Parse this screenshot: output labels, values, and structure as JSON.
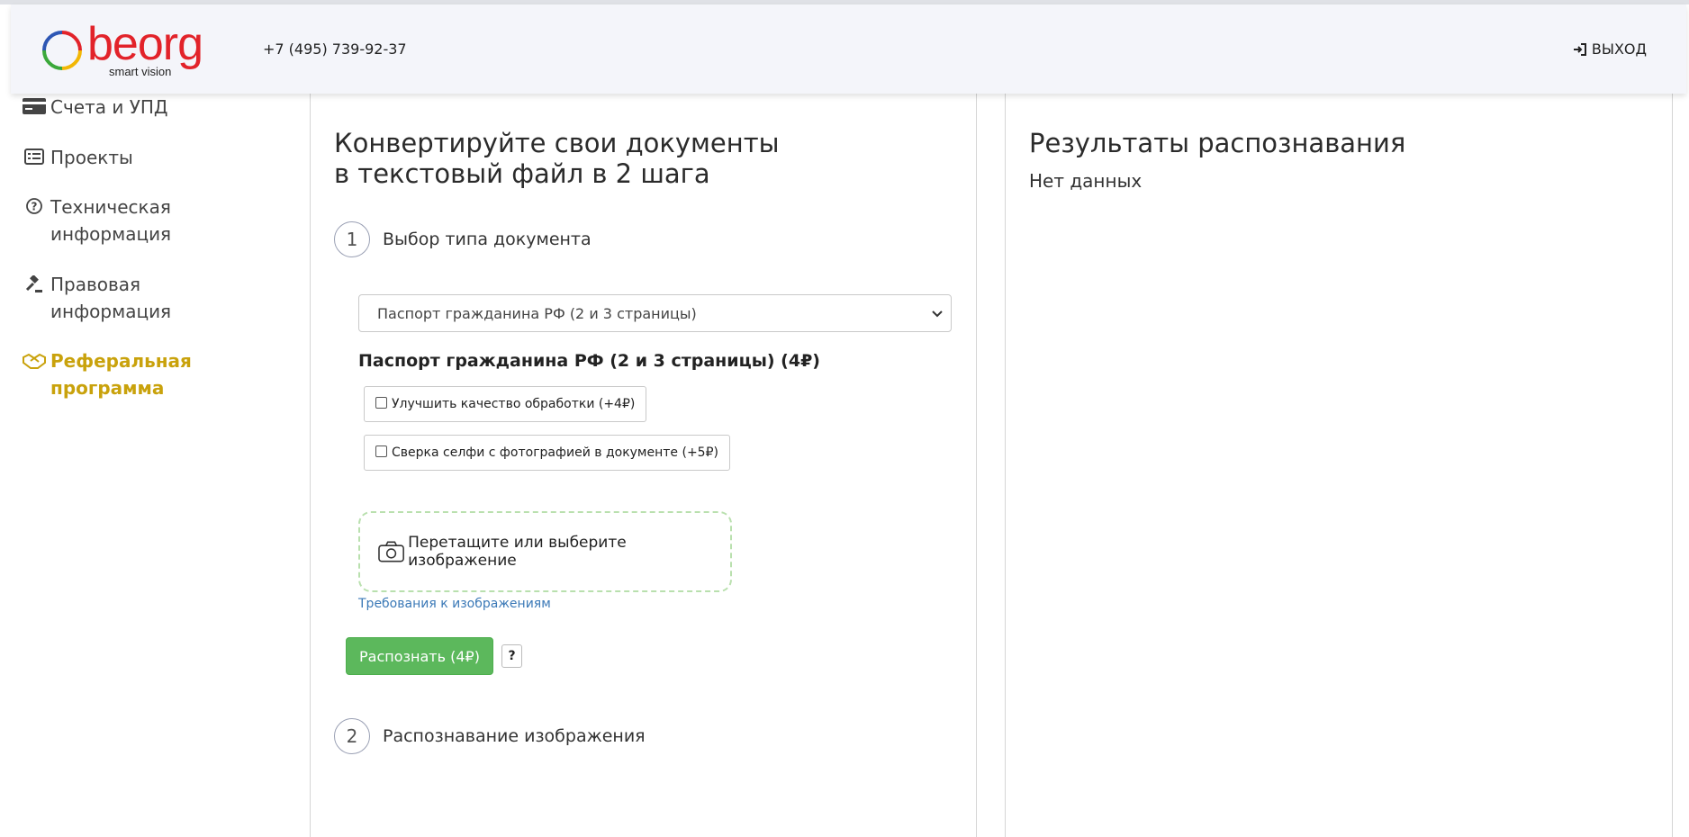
{
  "header": {
    "logo_text": "beorg",
    "logo_sub": "smart vision",
    "phone": "+7 (495) 739-92-37",
    "logout_label": "ВЫХОД"
  },
  "sidebar": {
    "items": [
      {
        "label": "Счета и УПД",
        "icon": "credit-card-icon"
      },
      {
        "label": "Проекты",
        "icon": "list-icon"
      },
      {
        "label": "Техническая\nинформация",
        "icon": "question-circle-icon"
      },
      {
        "label": "Правовая\nинформация",
        "icon": "gavel-icon"
      },
      {
        "label": "Реферальная\nпрограмма",
        "icon": "handshake-icon",
        "active": true
      }
    ],
    "active_color": "#c9a20c"
  },
  "main": {
    "title_line1": "Конвертируйте свои документы",
    "title_line2": "в текстовый файл в 2 шага",
    "step1_num": "1",
    "step1_label": "Выбор типа документа",
    "select_value": "Паспорт гражданина РФ (2 и 3 страницы)",
    "doc_title": "Паспорт гражданина РФ (2 и 3 страницы) (4₽)",
    "option1": "Улучшить качество обработки (+4₽)",
    "option2": "Сверка селфи с фотографией в документе (+5₽)",
    "drop_label": "Перетащите или выберите изображение",
    "requirements_link": "Требования к изображениям",
    "recognize_button": "Распознать (4₽)",
    "help_button": "?",
    "step2_num": "2",
    "step2_label": "Распознавание изображения"
  },
  "results": {
    "title": "Результаты распознавания",
    "empty": "Нет данных"
  },
  "colors": {
    "brand_red": "#e2232a",
    "button_green": "#5cb85c",
    "link_blue": "#3b79b7",
    "header_bg": "#f4f5fa"
  }
}
